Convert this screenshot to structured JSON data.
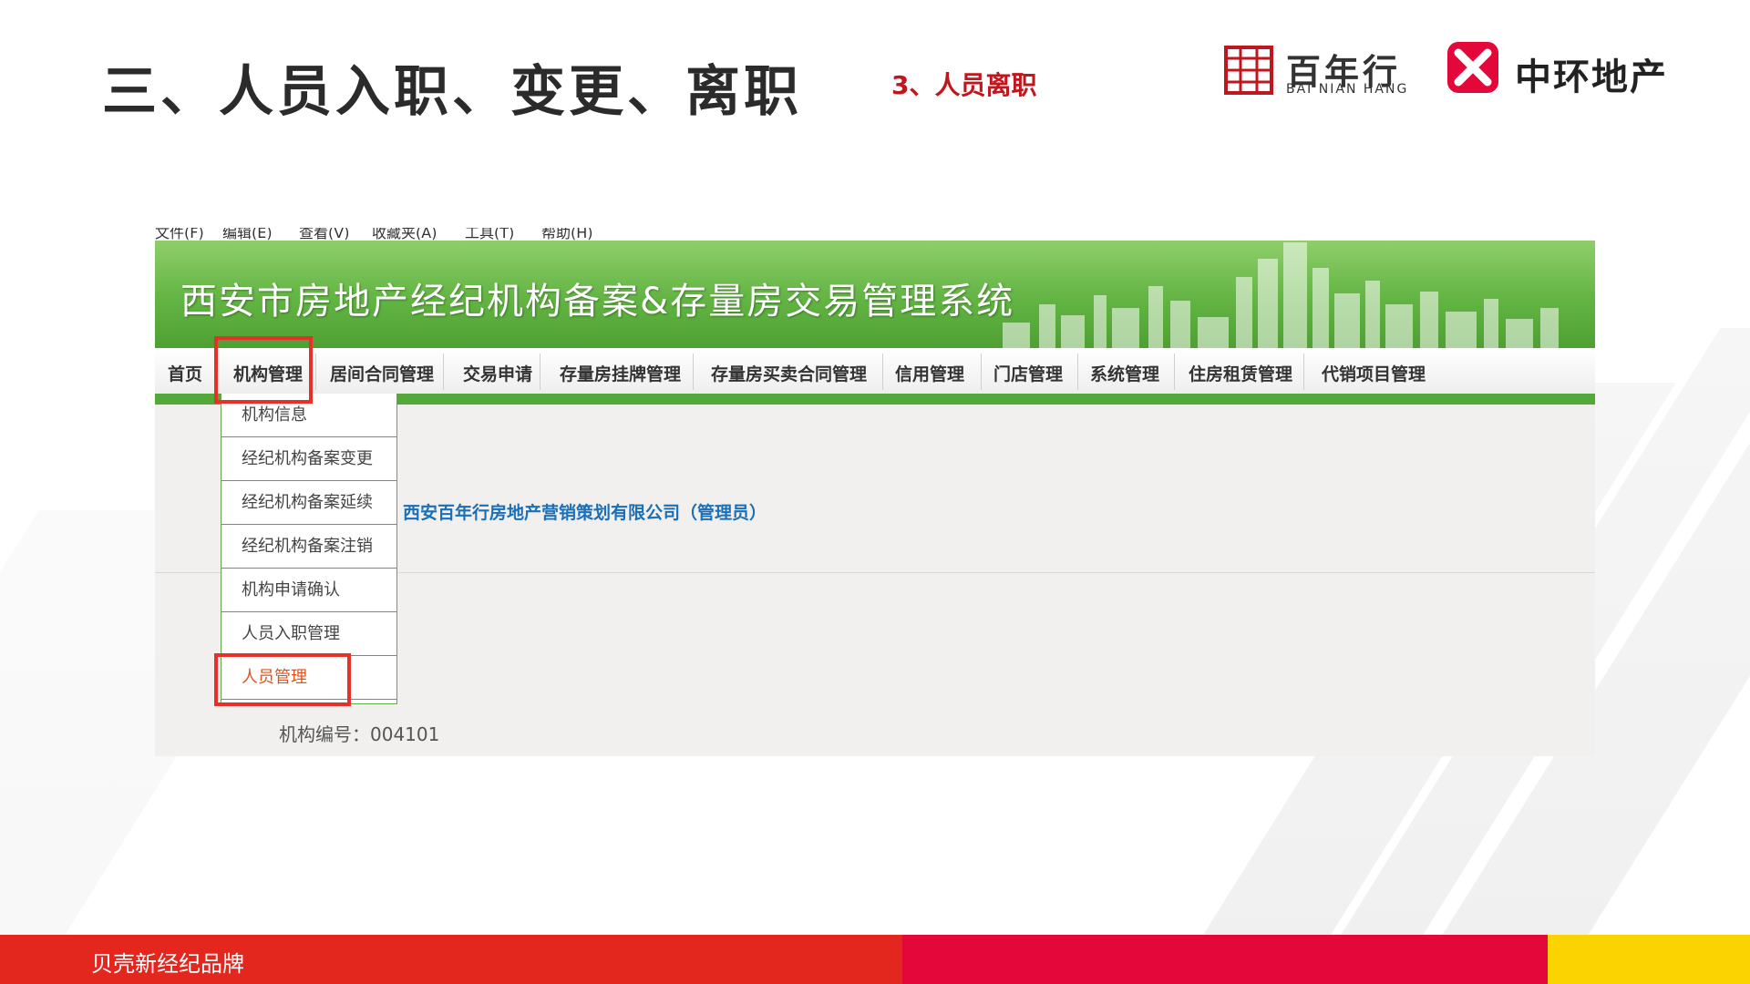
{
  "slide": {
    "title": "三、人员入职、变更、离职",
    "subtitle": "3、人员离职"
  },
  "logos": {
    "bainianhang_cn": "百年行",
    "bainianhang_en": "BAI NIAN HANG",
    "zhonghuan_cn": "中环地产"
  },
  "screenshot": {
    "browser_menu": [
      "文件(F)",
      "编辑(E)",
      "查看(V)",
      "收藏夹(A)",
      "工具(T)",
      "帮助(H)"
    ],
    "banner_title": "西安市房地产经纪机构备案&存量房交易管理系统",
    "nav": [
      "首页",
      "机构管理",
      "居间合同管理",
      "交易申请",
      "存量房挂牌管理",
      "存量房买卖合同管理",
      "信用管理",
      "门店管理",
      "系统管理",
      "住房租赁管理",
      "代销项目管理"
    ],
    "dropdown": [
      "机构信息",
      "经纪机构备案变更",
      "经纪机构备案延续",
      "经纪机构备案注销",
      "机构申请确认",
      "人员入职管理",
      "人员管理"
    ],
    "company": "西安百年行房地产营销策划有限公司（管理员）",
    "org_number": "机构编号：004101"
  },
  "footer": {
    "brand": "贝壳新经纪品牌"
  },
  "colors": {
    "accent_red": "#c0161d",
    "highlight_red": "#e8302a",
    "banner_green": "#62b443",
    "link_blue": "#1a6fb9",
    "footer_red": "#e3261e",
    "footer_crimson": "#e4073a",
    "footer_yellow": "#fbd400"
  }
}
